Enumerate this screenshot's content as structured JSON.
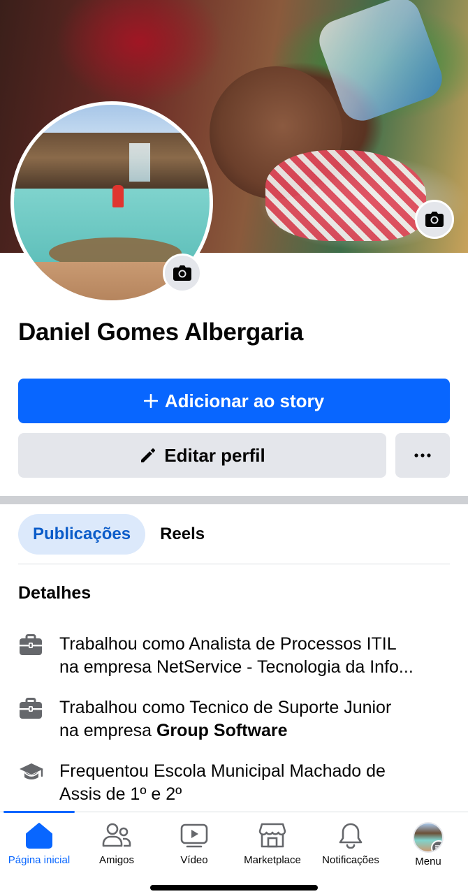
{
  "profile": {
    "name": "Daniel Gomes Albergaria"
  },
  "actions": {
    "add_story_label": "Adicionar ao story",
    "edit_profile_label": "Editar perfil",
    "more_label": "···"
  },
  "tabs": [
    {
      "label": "Publicações",
      "active": true
    },
    {
      "label": "Reels",
      "active": false
    }
  ],
  "details": {
    "title": "Detalhes",
    "items": [
      {
        "icon": "briefcase-icon",
        "line1": "Trabalhou como Analista de Processos ITIL",
        "line2": "na empresa NetService - Tecnologia da Info..."
      },
      {
        "icon": "briefcase-icon",
        "line1": "Trabalhou como Tecnico de Suporte Junior",
        "line2_prefix": "na empresa ",
        "line2_bold": "Group Software"
      },
      {
        "icon": "graduation-cap-icon",
        "line1": "Frequentou Escola Municipal Machado de",
        "line2": "Assis de 1º e 2º"
      }
    ]
  },
  "bottom_nav": [
    {
      "label": "Página inicial",
      "icon": "home-icon",
      "active": true
    },
    {
      "label": "Amigos",
      "icon": "friends-icon",
      "active": false
    },
    {
      "label": "Vídeo",
      "icon": "video-icon",
      "active": false
    },
    {
      "label": "Marketplace",
      "icon": "marketplace-icon",
      "active": false
    },
    {
      "label": "Notificações",
      "icon": "bell-icon",
      "active": false
    },
    {
      "label": "Menu",
      "icon": "profile-avatar",
      "active": false
    }
  ],
  "colors": {
    "primary": "#0866ff",
    "secondary_button": "#e4e6eb",
    "active_tab_bg": "#dce9fb",
    "active_tab_text": "#0b5cc9"
  }
}
